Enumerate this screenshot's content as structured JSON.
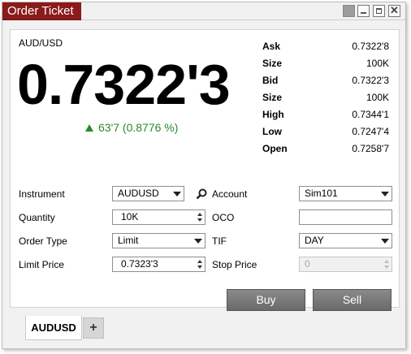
{
  "window": {
    "title": "Order Ticket",
    "controls": [
      "minimize",
      "maximize",
      "close"
    ],
    "close_glyph": "✕"
  },
  "quote": {
    "instrument": "AUD/USD",
    "last_price": "0.7322'3",
    "change": "63'7 (0.8776 %)",
    "direction": "up",
    "change_color": "#2a8a2a",
    "details": [
      {
        "label": "Ask",
        "value": "0.7322'8"
      },
      {
        "label": "Size",
        "value": "100K"
      },
      {
        "label": "Bid",
        "value": "0.7322'3"
      },
      {
        "label": "Size",
        "value": "100K"
      },
      {
        "label": "High",
        "value": "0.7344'1"
      },
      {
        "label": "Low",
        "value": "0.7247'4"
      },
      {
        "label": "Open",
        "value": "0.7258'7"
      }
    ]
  },
  "order_form": {
    "instrument": {
      "label": "Instrument",
      "value": "AUDUSD"
    },
    "account": {
      "label": "Account",
      "value": "Sim101"
    },
    "quantity": {
      "label": "Quantity",
      "value": "10K"
    },
    "oco": {
      "label": "OCO",
      "value": ""
    },
    "order_type": {
      "label": "Order Type",
      "value": "Limit"
    },
    "tif": {
      "label": "TIF",
      "value": "DAY"
    },
    "limit_price": {
      "label": "Limit Price",
      "value": "0.7323'3"
    },
    "stop_price": {
      "label": "Stop Price",
      "value": "0"
    }
  },
  "actions": {
    "buy_label": "Buy",
    "sell_label": "Sell"
  },
  "tabs": [
    {
      "label": "AUDUSD",
      "active": true
    }
  ],
  "add_tab_label": "+",
  "colors": {
    "title_bar": "#8b1a1a",
    "up": "#2a8a2a",
    "button": "#777777"
  }
}
